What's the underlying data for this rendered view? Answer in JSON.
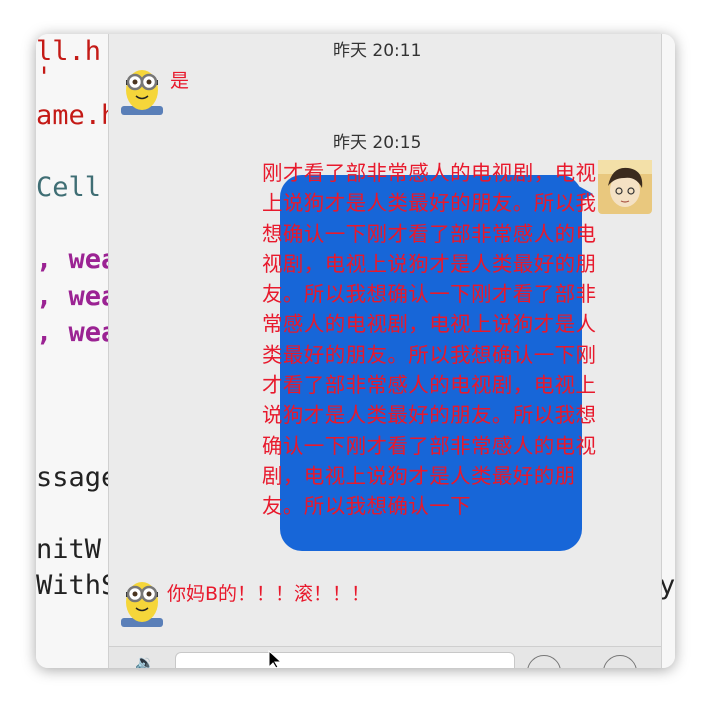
{
  "editor": {
    "lines": [
      {
        "text": "ll.h"
      },
      {
        "text": "'"
      },
      {
        "text": "ame.h"
      },
      {
        "text": "Cell"
      },
      {
        "text": ", wea"
      },
      {
        "text": ", wea"
      },
      {
        "text": ", wea"
      },
      {
        "text": "ssage"
      },
      {
        "text": "nitW"
      },
      {
        "text": "WithS"
      },
      {
        "text": "y"
      }
    ]
  },
  "chat": {
    "timestamp_1": "昨天 20:11",
    "msg_1": "是",
    "timestamp_2": "昨天 20:15",
    "msg_2": "刚才看了部非常感人的电视剧，电视上说狗才是人类最好的朋友。所以我想确认一下刚才看了部非常感人的电视剧，电视上说狗才是人类最好的朋友。所以我想确认一下刚才看了部非常感人的电视剧，电视上说狗才是人类最好的朋友。所以我想确认一下刚才看了部非常感人的电视剧，电视上说狗才是人类最好的朋友。所以我想确认一下刚才看了部非常感人的电视剧，电视上说狗才是人类最好的朋友。所以我想确认一下",
    "msg_3": "你妈B的！！！滚！！！"
  },
  "colors": {
    "bubble": "#1766d8",
    "message_text": "#e8192c"
  },
  "icons": [
    "voice-icon",
    "emoji-icon",
    "more-icon",
    "minion-avatar",
    "user-avatar"
  ]
}
